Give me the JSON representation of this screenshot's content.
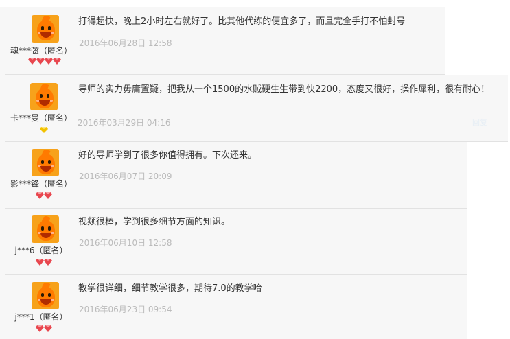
{
  "reviews": [
    {
      "user": "魂***弦（匿名）",
      "text": "打得超快，晚上2小时左右就好了。比其他代练的便宜多了，而且完全手打不怕封号",
      "date": "2016年06月28日 12:58",
      "badge": {
        "type": "heart-gem",
        "count": 4,
        "color": "#e8474f"
      }
    },
    {
      "user": "卡***曼（匿名）",
      "text": "导师的实力毋庸置疑，把我从一个1500的水贼硬生生带到快2200，态度又很好，操作犀利，很有耐心！",
      "date": "2016年03月29日 04:16",
      "badge": {
        "type": "diamond",
        "count": 1,
        "color": "#f2c200"
      },
      "side_link": "回复"
    },
    {
      "user": "影***锋（匿名）",
      "text": "好的导师学到了很多你值得拥有。下次还来。",
      "date": "2016年06月07日 20:09",
      "badge": {
        "type": "heart-gem",
        "count": 2,
        "color": "#e8474f"
      }
    },
    {
      "user": "j***6（匿名）",
      "text": "视频很棒，学到很多细节方面的知识。",
      "date": "2016年06月10日 12:58",
      "badge": {
        "type": "heart-gem",
        "count": 2,
        "color": "#e8474f"
      }
    },
    {
      "user": "j***1（匿名）",
      "text": "教学很详细，细节教学很多，期待7.0的教学哈",
      "date": "2016年06月23日 09:54",
      "badge": {
        "type": "heart-gem",
        "count": 2,
        "color": "#e8474f"
      }
    }
  ],
  "icons": {
    "avatar": "orange-mascot-avatar-icon",
    "rank": "gem-icon"
  }
}
